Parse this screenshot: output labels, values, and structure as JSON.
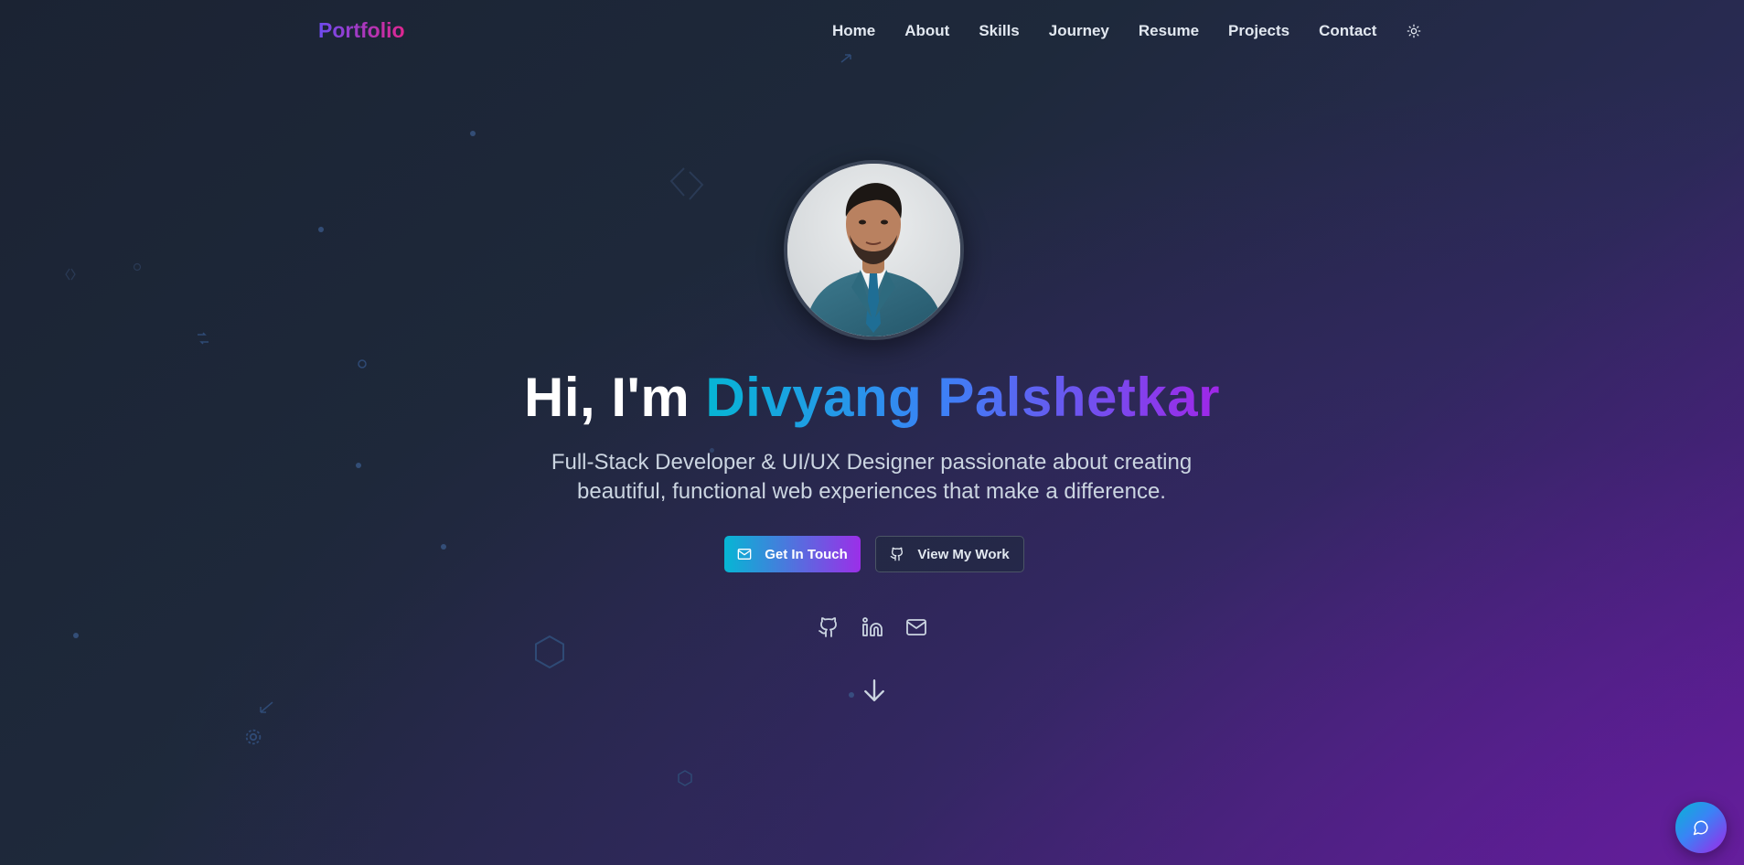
{
  "nav": {
    "logo": "Portfolio",
    "links": [
      "Home",
      "About",
      "Skills",
      "Journey",
      "Resume",
      "Projects",
      "Contact"
    ],
    "theme_toggle_icon": "sun-icon"
  },
  "hero": {
    "greeting": "Hi, I'm ",
    "name": "Divyang Palshetkar",
    "subtitle": "Full-Stack Developer & UI/UX Designer passionate about creating beautiful, functional web experiences that make a difference.",
    "primary_button": "Get In Touch",
    "primary_button_icon": "mail-icon",
    "secondary_button": "View My Work",
    "secondary_button_icon": "github-icon",
    "socials": [
      "github-icon",
      "linkedin-icon",
      "mail-icon"
    ],
    "scroll_icon": "arrow-down-icon"
  },
  "chat": {
    "icon": "chat-bubble-icon"
  },
  "colors": {
    "accent_start": "#06b6d4",
    "accent_mid": "#3b82f6",
    "accent_end": "#a026e8",
    "logo_start": "#6d4bf0",
    "logo_end": "#e0268f",
    "background": "#1e293b"
  }
}
